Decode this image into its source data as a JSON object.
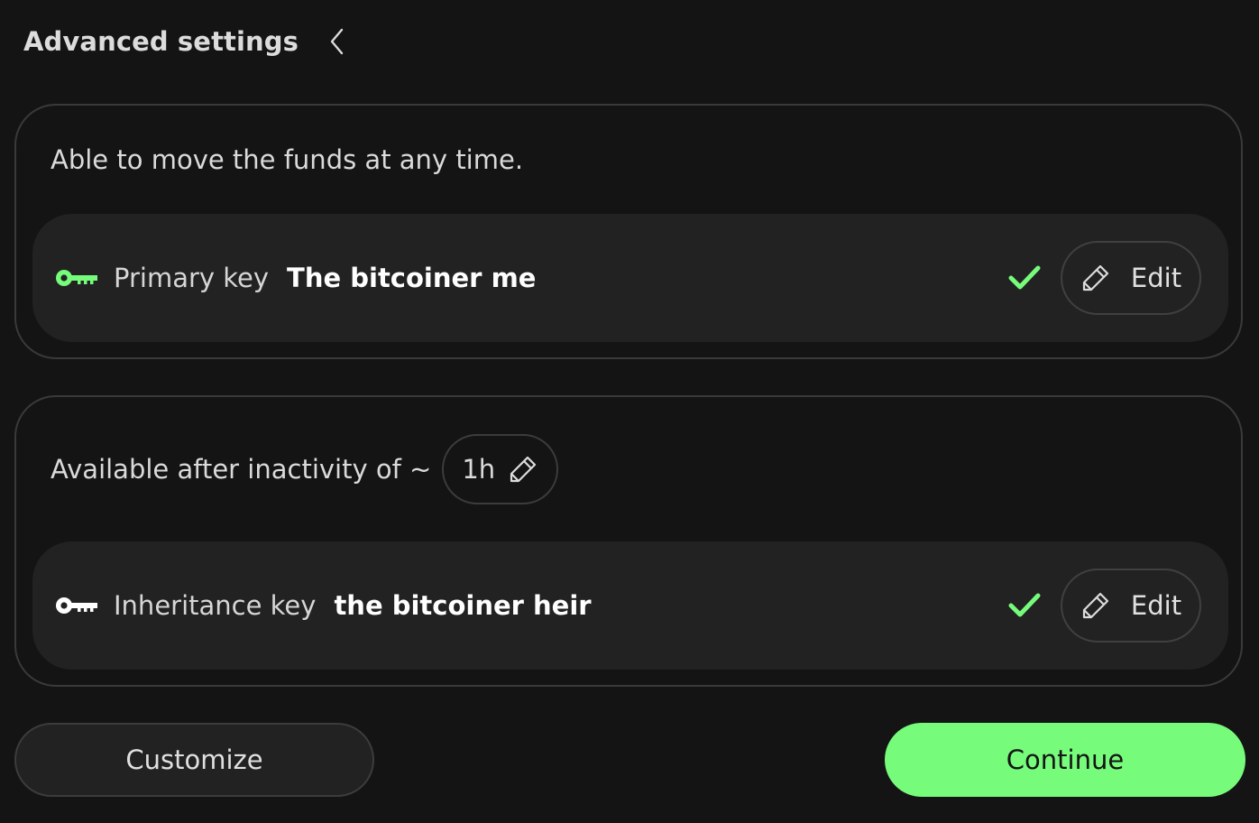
{
  "header": {
    "title": "Advanced settings",
    "back_icon": "chevron-left-icon"
  },
  "colors": {
    "background": "#141414",
    "accent": "#76fb7b",
    "card_border": "#3a3a3a",
    "row_background": "#222222"
  },
  "primary_path": {
    "description": "Able to move the funds at any time.",
    "key": {
      "icon": "key-icon",
      "icon_color": "#76fb7b",
      "type_label": "Primary key",
      "name": "The bitcoiner me",
      "status_icon": "check-icon",
      "edit_label": "Edit"
    }
  },
  "recovery_path": {
    "description": "Available after inactivity of ~",
    "timelock": {
      "value": "1h",
      "icon": "pencil-icon"
    },
    "key": {
      "icon": "key-icon",
      "icon_color": "#ffffff",
      "type_label": "Inheritance key",
      "name": "the bitcoiner heir",
      "status_icon": "check-icon",
      "edit_label": "Edit"
    }
  },
  "footer": {
    "customize_label": "Customize",
    "continue_label": "Continue"
  }
}
